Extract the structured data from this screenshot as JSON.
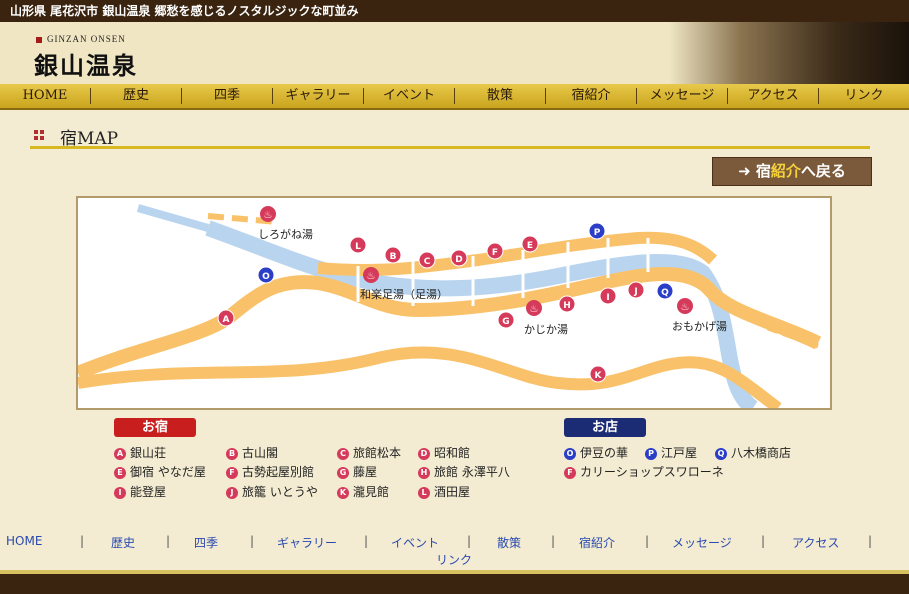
{
  "topbar": {
    "text": "山形県 尾花沢市 銀山温泉 郷愁を感じるノスタルジックな町並み"
  },
  "header": {
    "sub": "GINZAN ONSEN",
    "title": "銀山温泉"
  },
  "nav": [
    "HOME",
    "歴史",
    "四季",
    "ギャラリー",
    "イベント",
    "散策",
    "宿紹介",
    "メッセージ",
    "アクセス",
    "リンク"
  ],
  "section": {
    "title": "宿MAP"
  },
  "back_button": {
    "prefix": "➜ 宿",
    "highlight": "紹介",
    "suffix": "へ戻る"
  },
  "map": {
    "labels": {
      "shirogane": "しろがね湯",
      "wara": "和楽足湯（足湯）",
      "kajika": "かじか湯",
      "omokage": "おもかげ湯"
    },
    "markers": [
      "A",
      "B",
      "C",
      "D",
      "E",
      "F",
      "G",
      "H",
      "I",
      "J",
      "K",
      "L",
      "O",
      "P",
      "Q"
    ]
  },
  "legend": {
    "inn_title": "お宿",
    "shop_title": "お店",
    "inns": [
      {
        "key": "A",
        "name": "銀山荘"
      },
      {
        "key": "B",
        "name": "古山閣"
      },
      {
        "key": "C",
        "name": "旅館松本"
      },
      {
        "key": "D",
        "name": "昭和館"
      },
      {
        "key": "E",
        "name": "御宿 やなだ屋"
      },
      {
        "key": "F",
        "name": "古勢起屋別館"
      },
      {
        "key": "G",
        "name": "藤屋"
      },
      {
        "key": "H",
        "name": "旅館 永澤平八"
      },
      {
        "key": "I",
        "name": "能登屋"
      },
      {
        "key": "J",
        "name": "旅籠 いとうや"
      },
      {
        "key": "K",
        "name": "瀧見館"
      },
      {
        "key": "L",
        "name": "酒田屋"
      }
    ],
    "shops": [
      {
        "key": "O",
        "name": "伊豆の華"
      },
      {
        "key": "P",
        "name": "江戸屋"
      },
      {
        "key": "Q",
        "name": "八木橋商店"
      },
      {
        "key": "F",
        "name": "カリーショップスワローネ"
      }
    ]
  },
  "footer_nav": [
    "HOME",
    "歴史",
    "四季",
    "ギャラリー",
    "イベント",
    "散策",
    "宿紹介",
    "メッセージ",
    "アクセス",
    "リンク"
  ],
  "colors": {
    "road": "#f9c26a",
    "river": "#b9d4ee",
    "inn_marker": "#d63a5a",
    "shop_marker": "#2a3ec8"
  }
}
